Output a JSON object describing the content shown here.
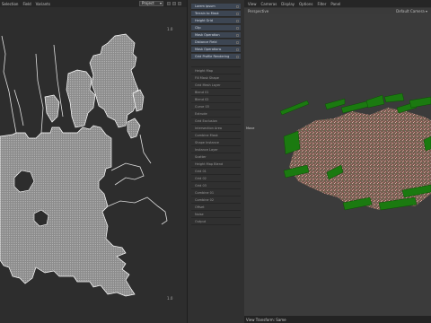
{
  "left_panel": {
    "menu": [
      "Selection",
      "Field",
      "Variants"
    ],
    "dropdown_value": "Project",
    "corner_label": "1.0"
  },
  "node_list": {
    "items": [
      {
        "label": "Lorem ipsum",
        "selected": true
      },
      {
        "label": "Terrain to Mask",
        "selected": true
      },
      {
        "label": "Height Grid",
        "selected": true
      },
      {
        "label": "Clip",
        "selected": true
      },
      {
        "label": "Mask Operation",
        "selected": true
      },
      {
        "label": "Distance Field",
        "selected": true
      },
      {
        "label": "Mask Operations",
        "selected": true
      },
      {
        "label": "Grid Profile Rendering",
        "selected": true
      },
      {
        "label": "",
        "selected": false
      },
      {
        "label": "Height Map",
        "selected": false
      },
      {
        "label": "Fill Mask Shape",
        "selected": false
      },
      {
        "label": "Grid Mesh Layer",
        "selected": false
      },
      {
        "label": "Blend 01",
        "selected": false
      },
      {
        "label": "Blend 02",
        "selected": false
      },
      {
        "label": "Curve 03",
        "selected": false
      },
      {
        "label": "Extrude",
        "selected": false
      },
      {
        "label": "Grid Exclusion",
        "selected": false
      },
      {
        "label": "Intersection Area",
        "selected": false
      },
      {
        "label": "Combine Mask",
        "selected": false
      },
      {
        "label": "Shape Instance",
        "selected": false
      },
      {
        "label": "Instance Layer",
        "selected": false
      },
      {
        "label": "Scatter",
        "selected": false
      },
      {
        "label": "Height Map Blend",
        "selected": false
      },
      {
        "label": "Grid 01",
        "selected": false
      },
      {
        "label": "Grid 02",
        "selected": false
      },
      {
        "label": "Grid 03",
        "selected": false
      },
      {
        "label": "Combine 01",
        "selected": false
      },
      {
        "label": "Combine 02",
        "selected": false
      },
      {
        "label": "Offset",
        "selected": false
      },
      {
        "label": "Noise",
        "selected": false
      },
      {
        "label": "Output",
        "selected": false
      }
    ]
  },
  "viewport": {
    "menu": [
      "View",
      "Cameras",
      "Display",
      "Options",
      "Filter",
      "Panel"
    ],
    "title": "Perspective",
    "camera": "Default Camera",
    "side_label": "Move",
    "status": "View Transform: Same"
  },
  "colors": {
    "bg": "#2a2a2a",
    "mask_fill": "#9a9a9a",
    "mask_edge": "#ffffff",
    "city": "#8a6458",
    "walls": "#1e7a12"
  }
}
